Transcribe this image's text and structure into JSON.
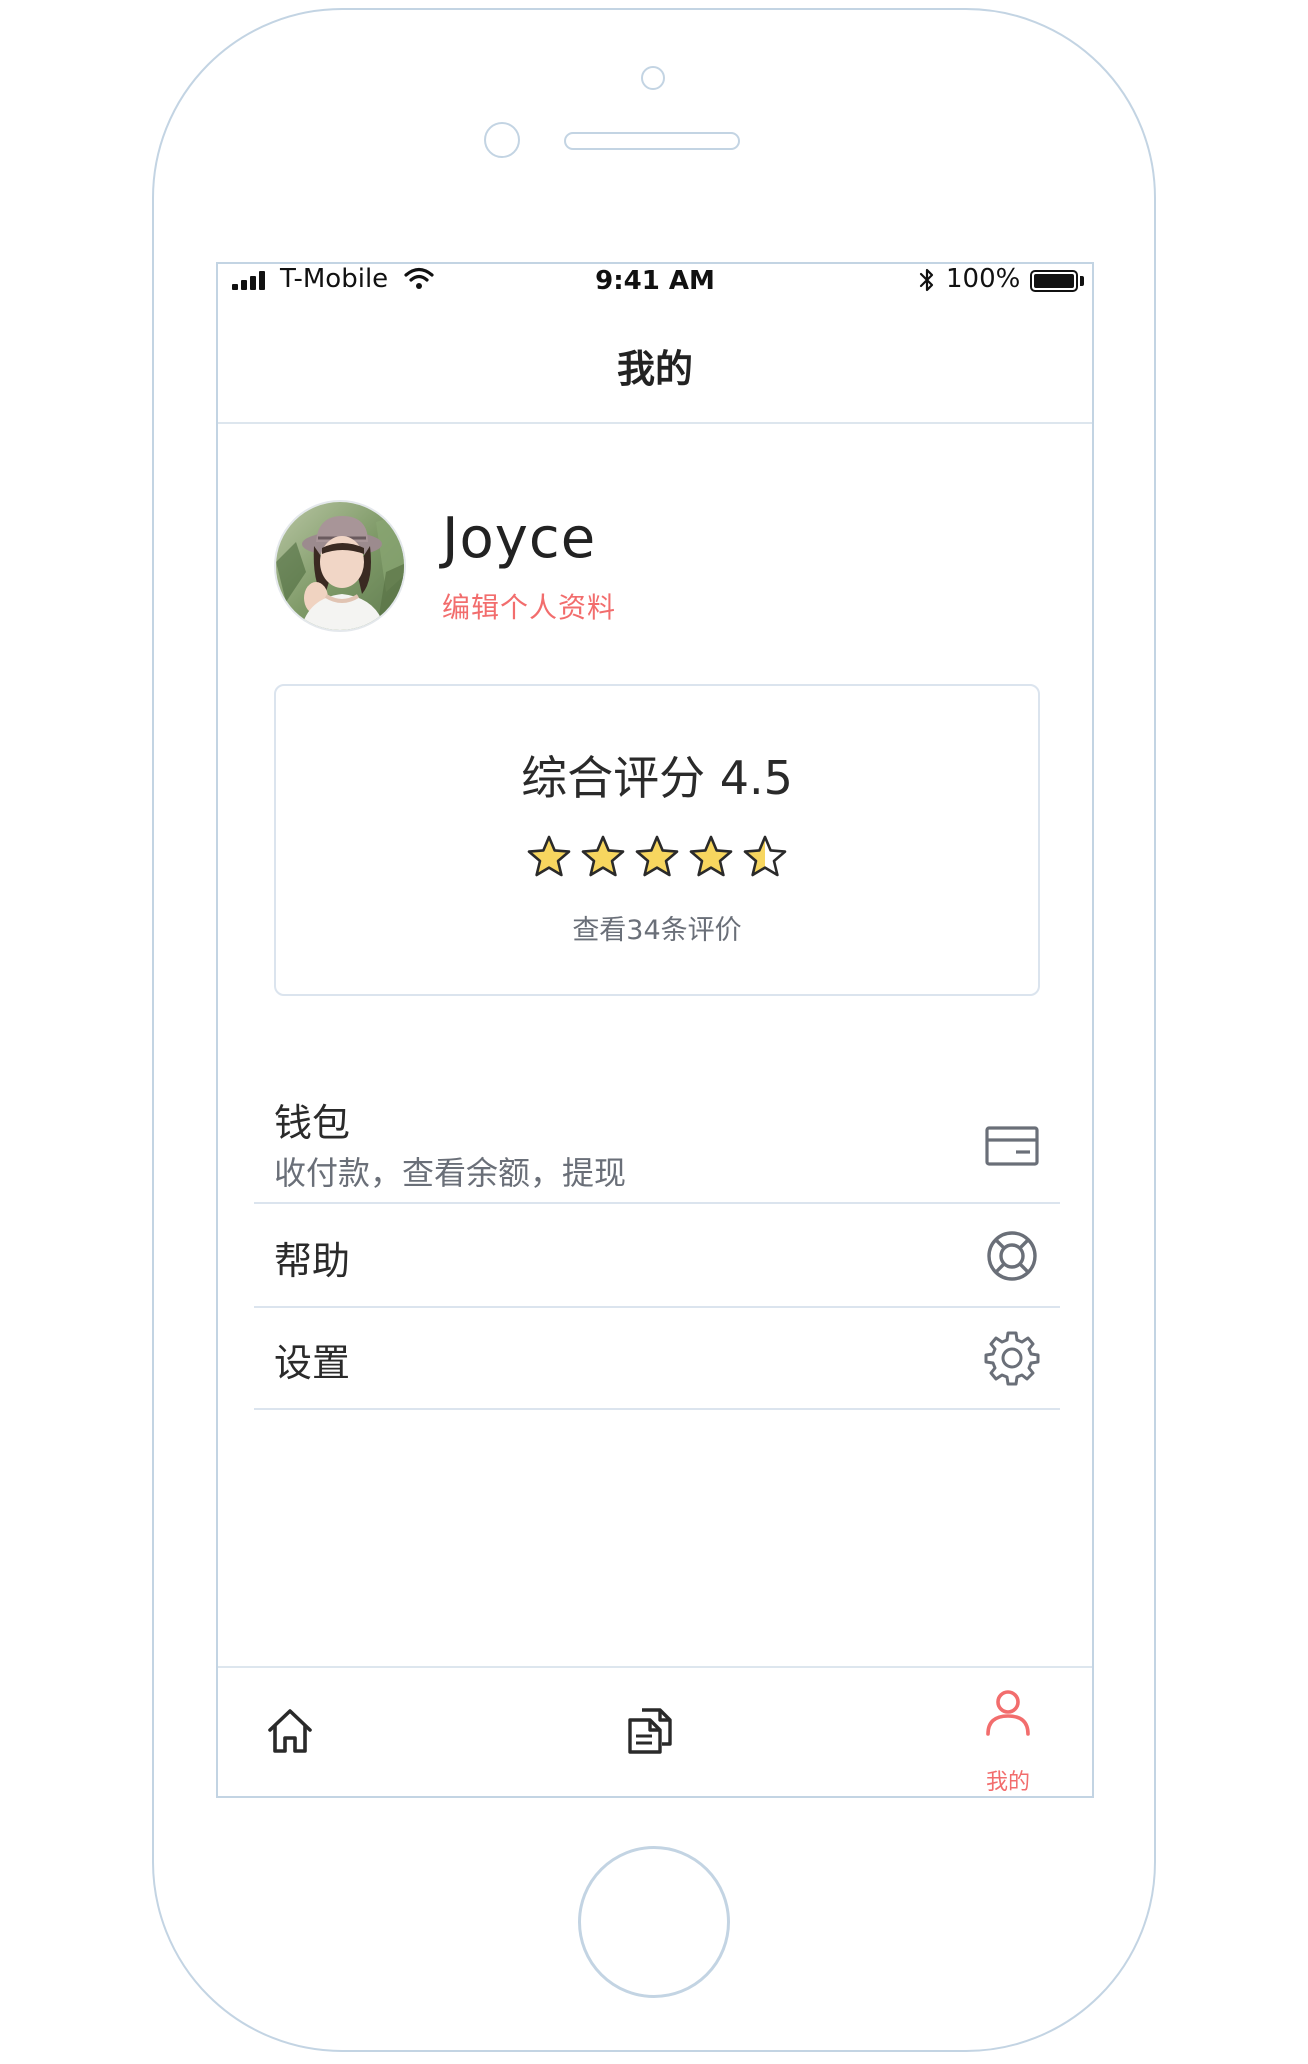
{
  "status_bar": {
    "carrier": "T-Mobile",
    "time": "9:41 AM",
    "battery": "100%"
  },
  "nav": {
    "title": "我的"
  },
  "profile": {
    "name": "Joyce",
    "edit_link": "编辑个人资料"
  },
  "rating": {
    "text": "综合评分 4.5",
    "stars": 4.5,
    "max_stars": 5,
    "reviews_link": "查看34条评价"
  },
  "menu": {
    "wallet": {
      "label": "钱包",
      "subtitle": "收付款，查看余额，提现",
      "icon": "wallet-card-icon"
    },
    "help": {
      "label": "帮助",
      "icon": "lifebuoy-icon"
    },
    "settings": {
      "label": "设置",
      "icon": "gear-icon"
    }
  },
  "tab_bar": {
    "home": {
      "icon": "home-icon"
    },
    "documents": {
      "icon": "documents-icon"
    },
    "me": {
      "icon": "user-icon",
      "label": "我的",
      "active": true
    }
  },
  "colors": {
    "accent": "#f26d6d",
    "star": "#f7d65f",
    "frame": "#c3d4e3",
    "divider": "#dbe4ee"
  }
}
